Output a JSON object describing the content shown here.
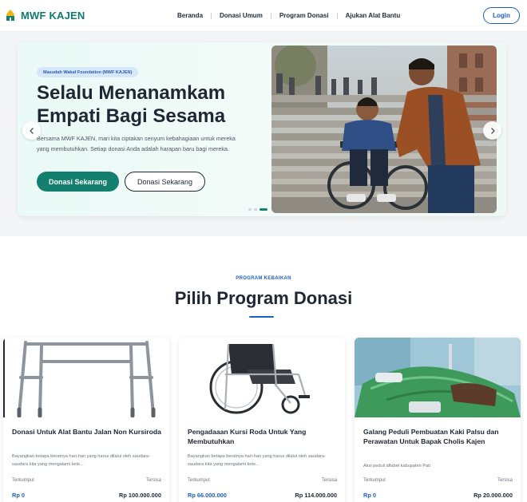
{
  "brand": {
    "name": "MWF KAJEN",
    "primary_color": "#13806f"
  },
  "nav": {
    "items": [
      "Beranda",
      "Donasi Umum",
      "Program Donasi",
      "Ajukan Alat Bantu"
    ],
    "login_label": "Login"
  },
  "hero": {
    "badge": "Masudah Wakaf Foundation (MWF KAJEN)",
    "title": "Selalu Menanamkam Empati Bagi Sesama",
    "description": "Bersama MWF KAJEN, mari kita ciptakan senyum kebahagiaan untuk mereka yang membutuhkan. Setiap donasi Anda adalah harapan baru bagi mereka.",
    "primary_button": "Donasi Sekarang",
    "secondary_button": "Donasi Sekarang",
    "slides_total": 3,
    "slide_active": 3,
    "prev_icon": "chevron-left-icon",
    "next_icon": "chevron-right-icon"
  },
  "section": {
    "eyebrow": "PROGRAM KEBAIKAN",
    "title": "Pilih Program Donasi",
    "accent_color": "#1f5fbf"
  },
  "programs": [
    {
      "title": "Donasi Untuk Alat Bantu Jalan Non Kursiroda",
      "description": "Bayangkan betapa beratnya hari-hari yang harus dilalui oleh saudara-saudara kita yang mengalami kete...",
      "collected_label": "Terkumpul",
      "collected": "Rp 0",
      "remaining_label": "Tersisa",
      "remaining": "Rp 100.000.000",
      "image": "walker-image"
    },
    {
      "title": "Pengadaaan Kursi Roda Untuk Yang Membutuhkan",
      "description": "Bayangkan betapa beratnya hari-hari yang harus dilalui oleh saudara-saudara kita yang mengalami kete...",
      "collected_label": "Terkumpul",
      "collected": "Rp 66.000.000",
      "remaining_label": "Tersisa",
      "remaining": "Rp 114.000.000",
      "image": "wheelchair-image"
    },
    {
      "title": "Galang Peduli Pembuatan Kaki Palsu dan Perawatan Untuk Bapak Cholis Kajen",
      "description": "Aksi peduli difabel kabupaten Pati",
      "collected_label": "Terkumpul",
      "collected": "Rp 0",
      "remaining_label": "Tersisa",
      "remaining": "Rp 20.000.000",
      "image": "hospital-patient-image"
    }
  ]
}
